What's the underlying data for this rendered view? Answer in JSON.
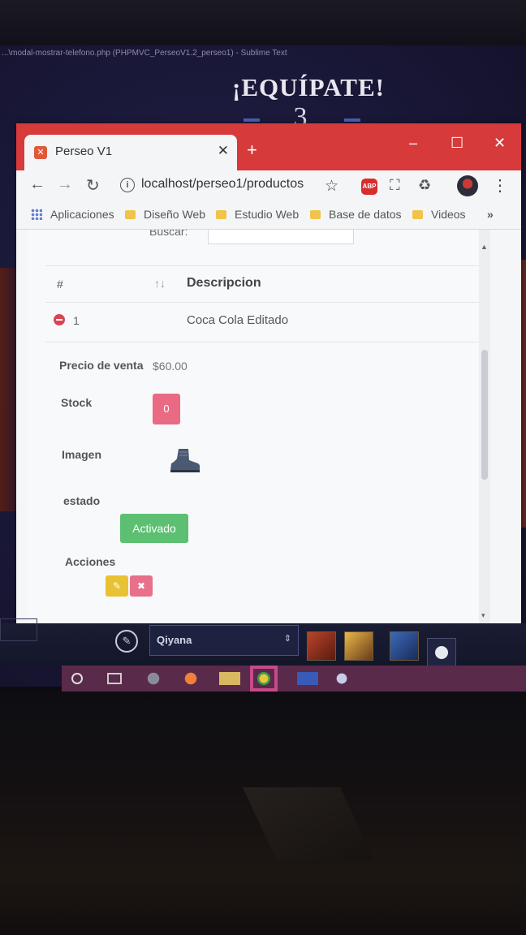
{
  "editor": {
    "title_fragment": "...\\modal-mostrar-telefono.php (PHPMVC_PerseoV1.2_perseo1) - Sublime Text"
  },
  "promo": {
    "title": "¡EQUÍPATE!",
    "number": "3"
  },
  "browser": {
    "tab_title": "Perseo V1",
    "new_tab_symbol": "+",
    "url": "localhost/perseo1/productos",
    "abp_label": "ABP",
    "bookmarks": {
      "apps": "Aplicaciones",
      "items": [
        "Diseño Web",
        "Estudio Web",
        "Base de datos",
        "Videos"
      ],
      "more": "»"
    }
  },
  "page": {
    "search_label": "Buscar:",
    "table": {
      "headers": {
        "number": "#",
        "description": "Descripcion"
      },
      "rows": [
        {
          "number": "1",
          "description": "Coca Cola Editado"
        }
      ]
    },
    "details": {
      "price_label": "Precio de venta",
      "price_value": "$60.00",
      "stock_label": "Stock",
      "stock_value": "0",
      "image_label": "Imagen",
      "status_label": "estado",
      "status_value": "Activado",
      "actions_label": "Acciones"
    }
  },
  "client": {
    "champion": "Qiyana"
  },
  "colors": {
    "titlebar": "#d63a3a",
    "stock_badge": "#ea6a84",
    "status_badge": "#5cbf72",
    "edit_button": "#e8c233",
    "delete_button": "#e8708a",
    "expand_icon": "#d94452"
  },
  "icons": [
    "back-arrow-icon",
    "forward-arrow-icon",
    "reload-icon",
    "info-icon",
    "star-icon",
    "adblock-icon",
    "screenshot-icon",
    "recycle-icon",
    "menu-dots-icon",
    "folder-icon",
    "apps-grid-icon",
    "sort-icon",
    "expand-icon",
    "boot-icon",
    "pencil-icon",
    "close-icon"
  ]
}
